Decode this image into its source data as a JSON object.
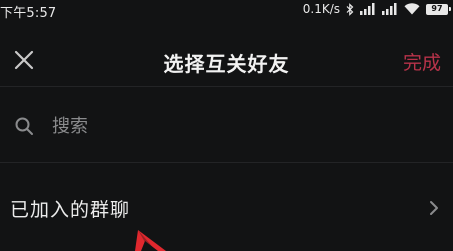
{
  "status_bar": {
    "time": "下午5:57",
    "network_speed": "0.1K/s",
    "battery_level": "97"
  },
  "header": {
    "title": "选择互关好友",
    "done_label": "完成",
    "done_color": "#b8334a"
  },
  "search": {
    "placeholder": "搜索",
    "value": ""
  },
  "group_chats": {
    "label": "已加入的群聊"
  },
  "icons": {
    "close": "close-icon",
    "search": "search-icon",
    "chevron": "chevron-right-icon",
    "bluetooth": "bluetooth-icon",
    "signal": "signal-icon",
    "wifi": "wifi-icon",
    "battery": "battery-icon",
    "annotation": "red-arrow-icon"
  },
  "colors": {
    "background": "#121314",
    "divider": "#232426",
    "annotation": "#e0282e"
  }
}
